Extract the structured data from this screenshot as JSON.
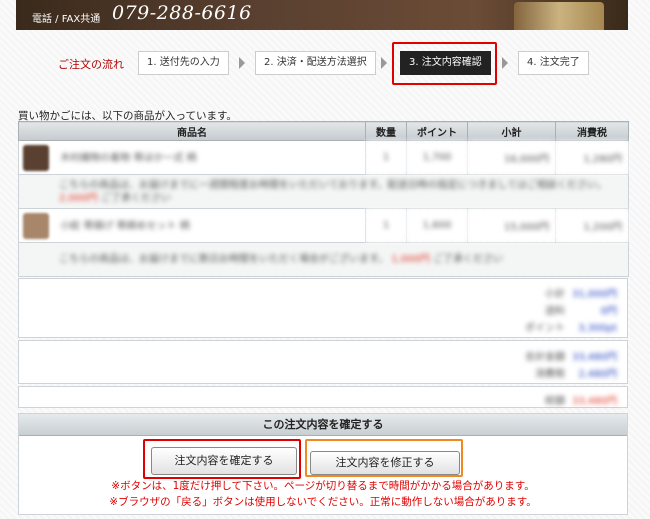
{
  "header": {
    "tel_label": "電話 / FAX共通",
    "tel_number": "079-288-6616"
  },
  "steps": {
    "label": "ご注文の流れ",
    "items": [
      {
        "label": "1. 送付先の入力"
      },
      {
        "label": "2. 決済・配送方法選択"
      },
      {
        "label": "3. 注文内容確認",
        "active": true
      },
      {
        "label": "4. 注文完了"
      }
    ]
  },
  "cart": {
    "intro": "買い物かごには、以下の商品が入っています。",
    "columns": [
      "商品名",
      "数量",
      "ポイント",
      "小計",
      "消費税"
    ],
    "rows": [
      {
        "name": "木村織物の着物 帯ほか一式 柄",
        "qty": "1",
        "points": "1,700",
        "subtotal": "16,000円",
        "tax": "1,280円"
      },
      {
        "note": "こちらの商品は、お届けまでに一週間程度お時間をいただいております。配送日時の指定につきましてはご相談ください。",
        "note_price": "2,000円",
        "note_tail": "ご了承ください"
      },
      {
        "name": "小紋 帯揚げ 帯締めセット 柄",
        "qty": "1",
        "points": "1,600",
        "subtotal": "15,000円",
        "tax": "1,200円"
      },
      {
        "note": "こちらの商品は、お届けまでに数日お時間をいただく場合がございます。",
        "note_price": "1,000円",
        "note_tail": "ご了承ください"
      }
    ],
    "summary1": [
      {
        "k": "小計",
        "v": "31,000円"
      },
      {
        "k": "送料",
        "v": "0円"
      },
      {
        "k": "ポイント",
        "v": "3,300pt"
      }
    ],
    "summary2": [
      {
        "k": "合計金額",
        "v": "33,480円"
      },
      {
        "k": "消費税",
        "v": "2,480円"
      }
    ],
    "total": {
      "k": "総額",
      "v": "33,480円"
    }
  },
  "confirm": {
    "title": "この注文内容を確定する",
    "submit_label": "注文内容を確定する",
    "modify_label": "注文内容を修正する",
    "notice1": "※ボタンは、1度だけ押して下さい。ページが切り替るまで時間がかかる場合があります。",
    "notice2": "※ブラウザの「戻る」ボタンは使用しないでください。正常に動作しない場合があります。"
  },
  "colors": {
    "highlight_red": "#e00000",
    "highlight_orange": "#f08a20",
    "step_active": "#222222"
  }
}
